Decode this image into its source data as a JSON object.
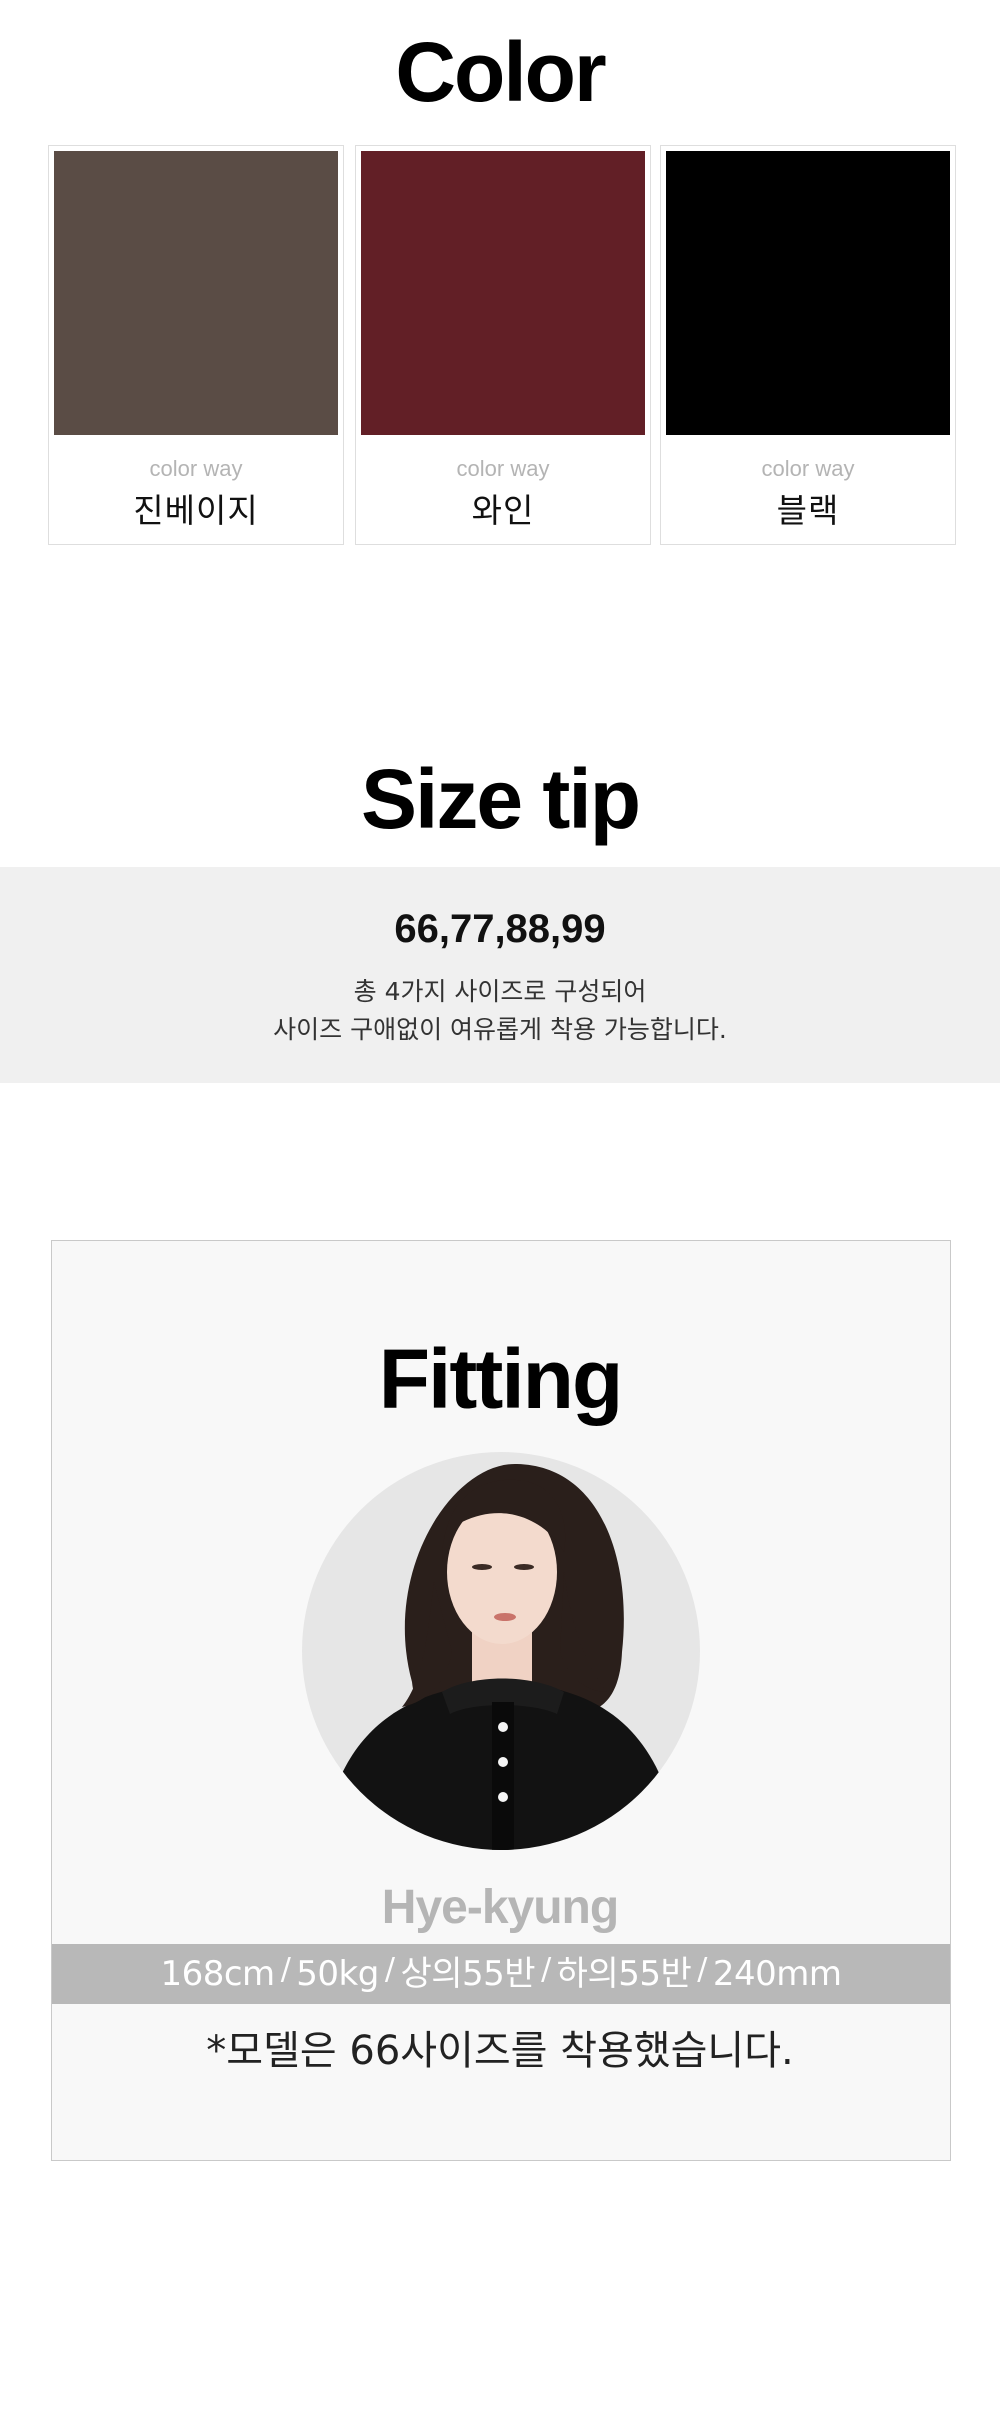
{
  "color_section": {
    "title": "Color",
    "swatches": [
      {
        "color": "#5a4c45",
        "caption": "color way",
        "name": "진베이지"
      },
      {
        "color": "#621f26",
        "caption": "color way",
        "name": "와인"
      },
      {
        "color": "#000000",
        "caption": "color way",
        "name": "블랙"
      }
    ]
  },
  "size_section": {
    "title": "Size tip",
    "sizes": "66,77,88,99",
    "line1": "총 4가지 사이즈로 구성되어",
    "line2": "사이즈 구애없이 여유롭게 착용 가능합니다."
  },
  "fitting_section": {
    "title": "Fitting",
    "model_name": "Hye-kyung",
    "specs": [
      "168cm",
      "50kg",
      "상의55반",
      "하의55반",
      "240mm"
    ],
    "note": "*모델은 66사이즈를 착용했습니다."
  }
}
